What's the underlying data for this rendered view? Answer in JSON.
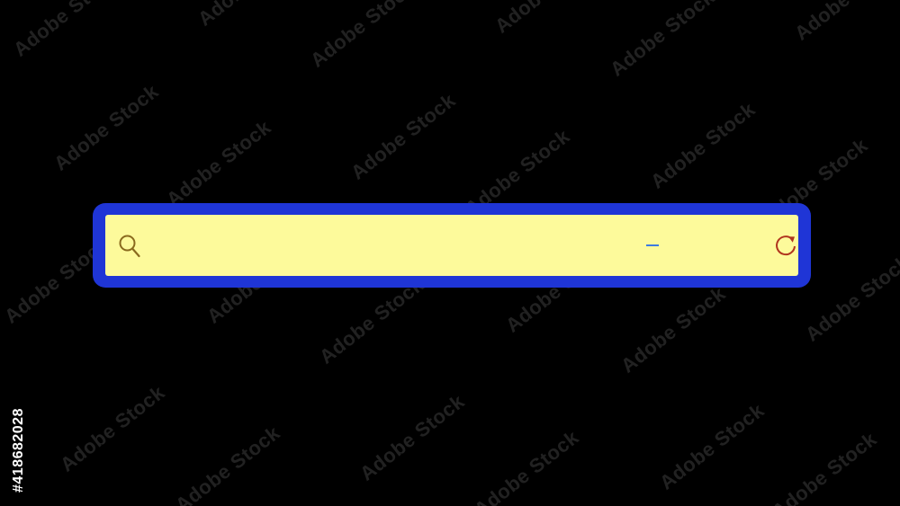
{
  "watermark": {
    "text": "Adobe Stock",
    "id_text": "#418682028"
  },
  "search": {
    "value": "",
    "placeholder": "",
    "search_icon": "search-icon",
    "refresh_icon": "refresh-icon"
  },
  "colors": {
    "background": "#000000",
    "frame": "#1f35d6",
    "field": "#fdfa9b",
    "search_icon": "#8a6a1e",
    "refresh_icon": "#b0351e",
    "caret": "#3d7be0"
  }
}
